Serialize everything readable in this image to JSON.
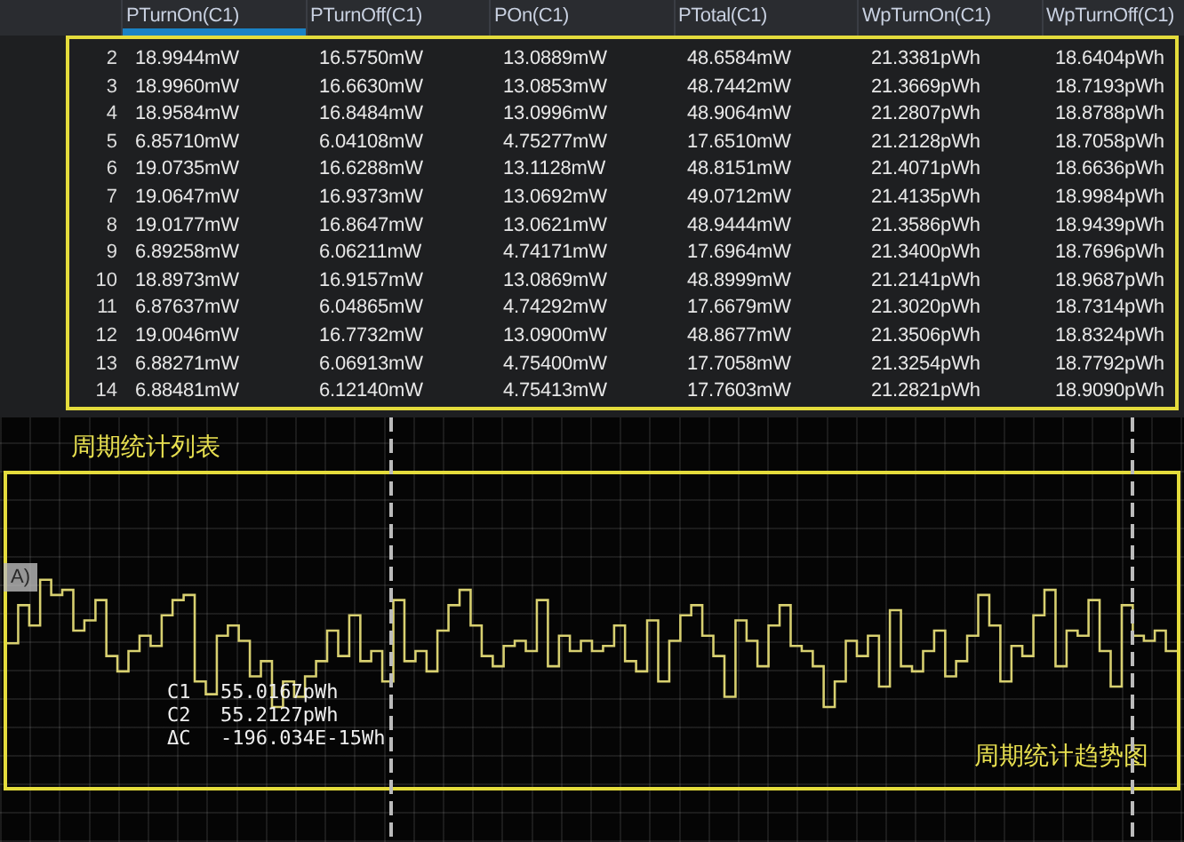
{
  "table": {
    "columns": [
      {
        "label": "PTurnOn(C1)",
        "selected": true
      },
      {
        "label": "PTurnOff(C1)",
        "selected": false
      },
      {
        "label": "POn(C1)",
        "selected": false
      },
      {
        "label": "PTotal(C1)",
        "selected": false
      },
      {
        "label": "WpTurnOn(C1)",
        "selected": false
      },
      {
        "label": "WpTurnOff(C1)",
        "selected": false
      }
    ],
    "rows": [
      {
        "index": "2",
        "cells": [
          "18.9944mW",
          "16.5750mW",
          "13.0889mW",
          "48.6584mW",
          "21.3381pWh",
          "18.6404pWh"
        ]
      },
      {
        "index": "3",
        "cells": [
          "18.9960mW",
          "16.6630mW",
          "13.0853mW",
          "48.7442mW",
          "21.3669pWh",
          "18.7193pWh"
        ]
      },
      {
        "index": "4",
        "cells": [
          "18.9584mW",
          "16.8484mW",
          "13.0996mW",
          "48.9064mW",
          "21.2807pWh",
          "18.8788pWh"
        ]
      },
      {
        "index": "5",
        "cells": [
          "6.85710mW",
          "6.04108mW",
          "4.75277mW",
          "17.6510mW",
          "21.2128pWh",
          "18.7058pWh"
        ]
      },
      {
        "index": "6",
        "cells": [
          "19.0735mW",
          "16.6288mW",
          "13.1128mW",
          "48.8151mW",
          "21.4071pWh",
          "18.6636pWh"
        ]
      },
      {
        "index": "7",
        "cells": [
          "19.0647mW",
          "16.9373mW",
          "13.0692mW",
          "49.0712mW",
          "21.4135pWh",
          "18.9984pWh"
        ]
      },
      {
        "index": "8",
        "cells": [
          "19.0177mW",
          "16.8647mW",
          "13.0621mW",
          "48.9444mW",
          "21.3586pWh",
          "18.9439pWh"
        ]
      },
      {
        "index": "9",
        "cells": [
          "6.89258mW",
          "6.06211mW",
          "4.74171mW",
          "17.6964mW",
          "21.3400pWh",
          "18.7696pWh"
        ]
      },
      {
        "index": "10",
        "cells": [
          "18.8973mW",
          "16.9157mW",
          "13.0869mW",
          "48.8999mW",
          "21.2141pWh",
          "18.9687pWh"
        ]
      },
      {
        "index": "11",
        "cells": [
          "6.87637mW",
          "6.04865mW",
          "4.74292mW",
          "17.6679mW",
          "21.3020pWh",
          "18.7314pWh"
        ]
      },
      {
        "index": "12",
        "cells": [
          "19.0046mW",
          "16.7732mW",
          "13.0900mW",
          "48.8677mW",
          "21.3506pWh",
          "18.8324pWh"
        ]
      },
      {
        "index": "13",
        "cells": [
          "6.88271mW",
          "6.06913mW",
          "4.75400mW",
          "17.7058mW",
          "21.3254pWh",
          "18.7792pWh"
        ]
      },
      {
        "index": "14",
        "cells": [
          "6.88481mW",
          "6.12140mW",
          "4.75413mW",
          "17.7603mW",
          "21.2821pWh",
          "18.9090pWh"
        ]
      }
    ]
  },
  "list_label": "周期统计列表",
  "trend": {
    "channel_tag": "A)",
    "readouts": [
      {
        "label": "C1",
        "value": "55.0167pWh"
      },
      {
        "label": "C2",
        "value": "55.2127pWh"
      },
      {
        "label": "ΔC",
        "value": "-196.034E-15Wh"
      }
    ],
    "title": "周期统计趋势图"
  }
}
